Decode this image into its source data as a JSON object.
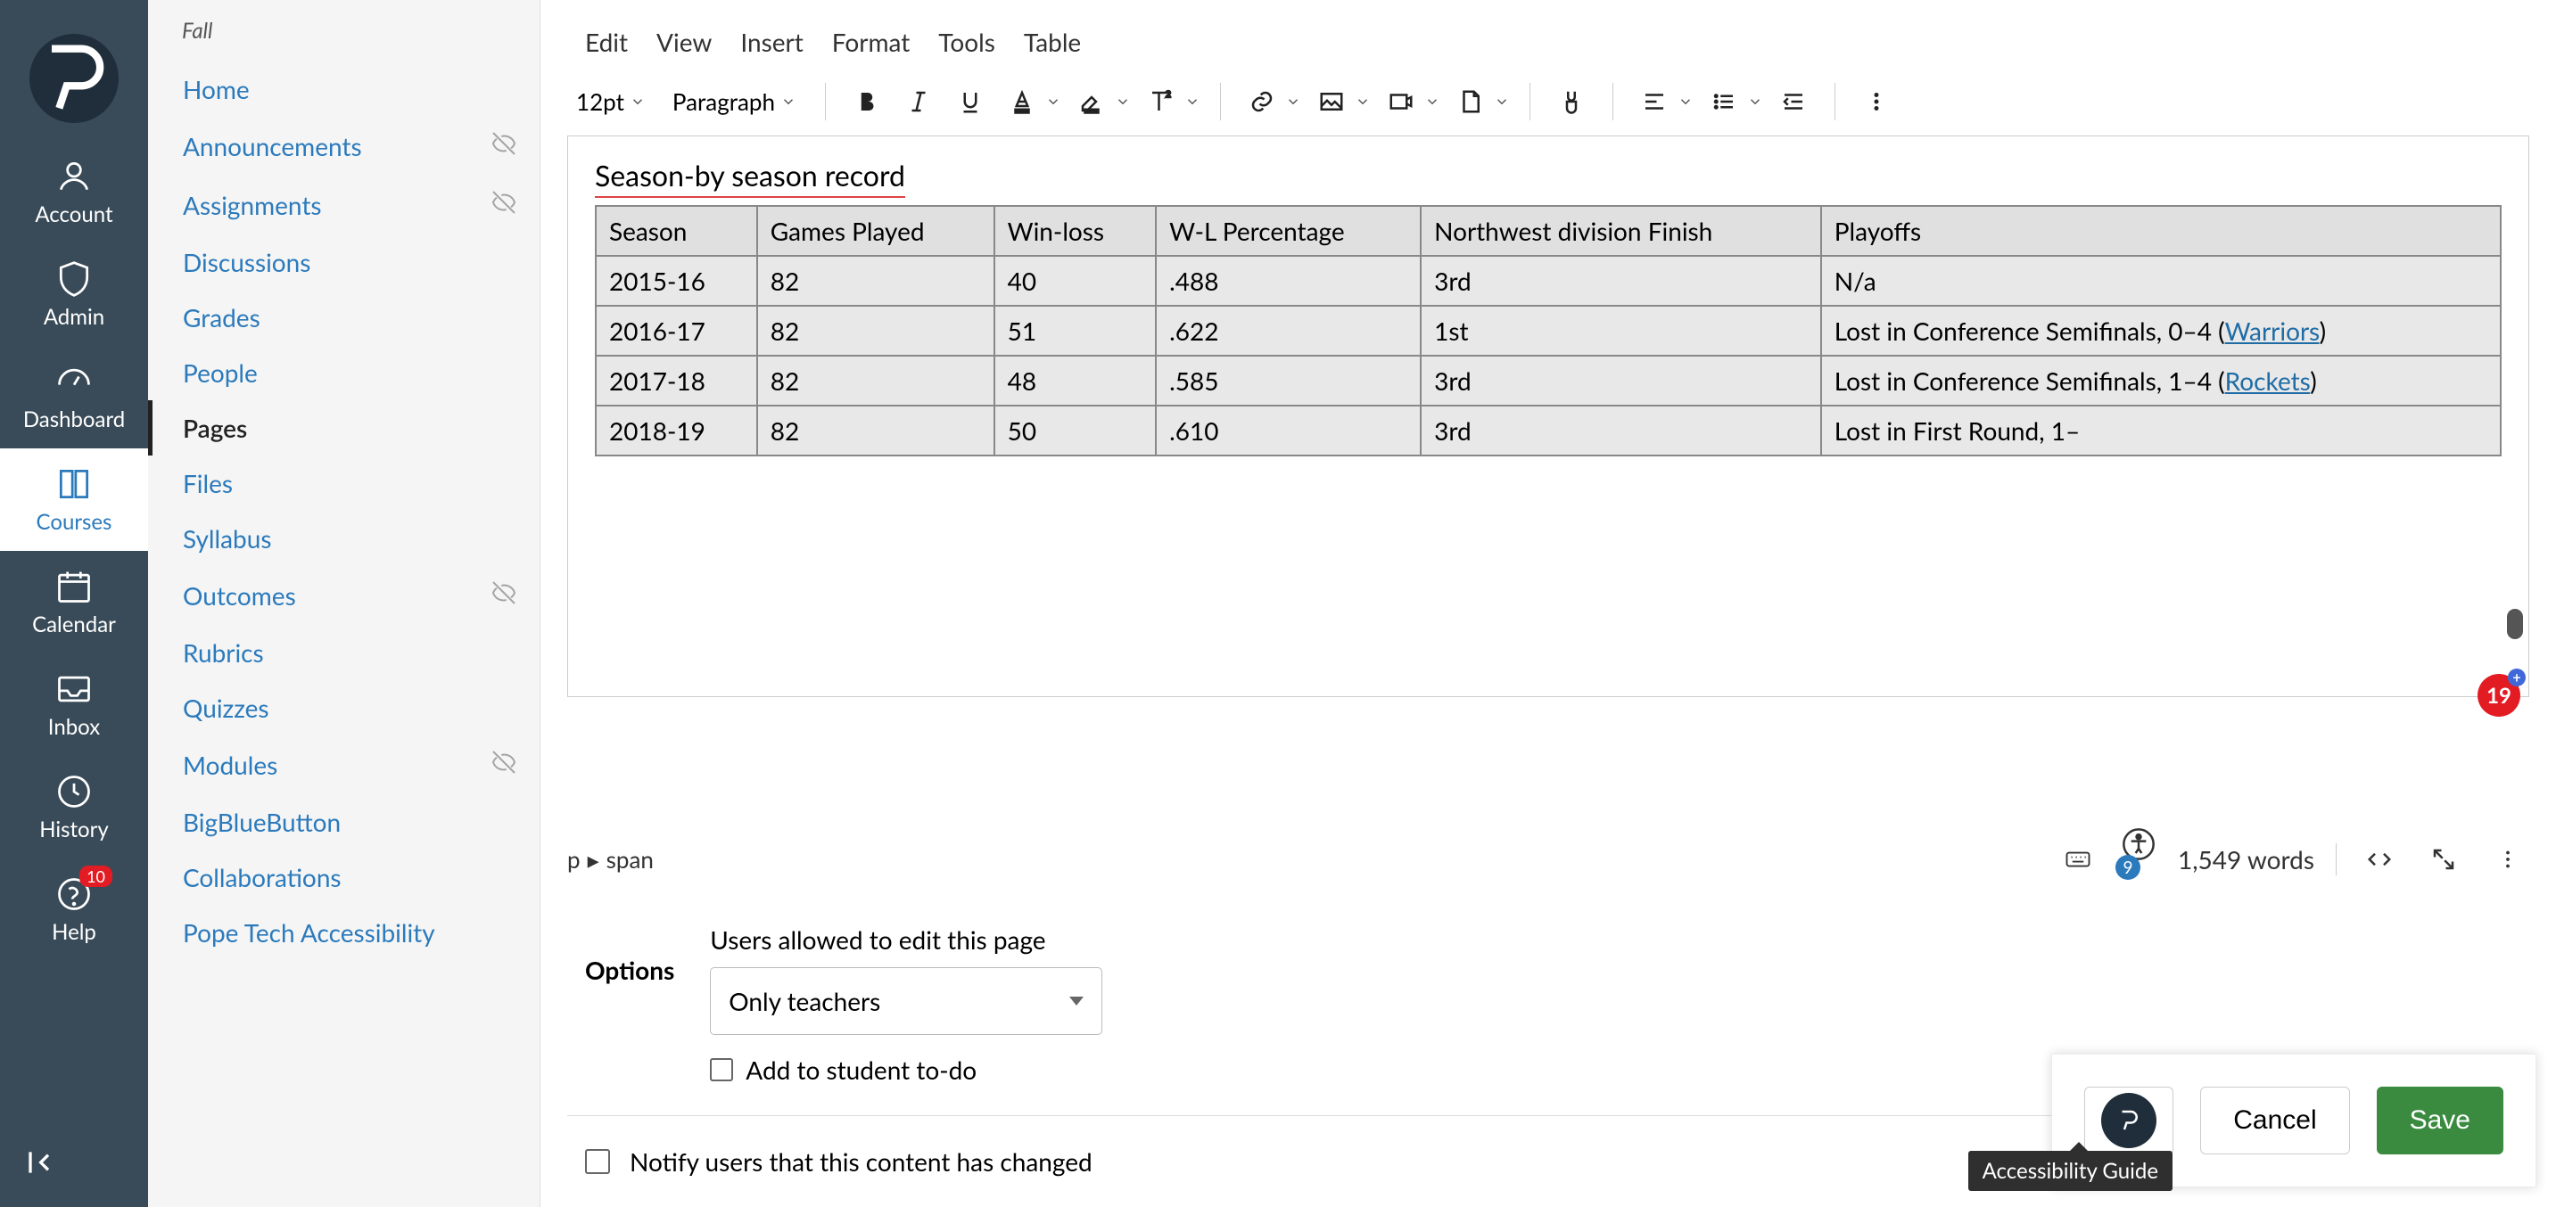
{
  "global_nav": {
    "items": [
      {
        "label": "Account",
        "icon": "user"
      },
      {
        "label": "Admin",
        "icon": "shield"
      },
      {
        "label": "Dashboard",
        "icon": "gauge"
      },
      {
        "label": "Courses",
        "icon": "book",
        "active": true
      },
      {
        "label": "Calendar",
        "icon": "calendar"
      },
      {
        "label": "Inbox",
        "icon": "inbox"
      },
      {
        "label": "History",
        "icon": "clock"
      },
      {
        "label": "Help",
        "icon": "help",
        "badge": "10"
      }
    ]
  },
  "course_nav": {
    "term": "Fall",
    "items": [
      {
        "label": "Home"
      },
      {
        "label": "Announcements",
        "hidden": true
      },
      {
        "label": "Assignments",
        "hidden": true
      },
      {
        "label": "Discussions"
      },
      {
        "label": "Grades"
      },
      {
        "label": "People"
      },
      {
        "label": "Pages",
        "active": true
      },
      {
        "label": "Files"
      },
      {
        "label": "Syllabus"
      },
      {
        "label": "Outcomes",
        "hidden": true
      },
      {
        "label": "Rubrics"
      },
      {
        "label": "Quizzes"
      },
      {
        "label": "Modules",
        "hidden": true
      },
      {
        "label": "BigBlueButton"
      },
      {
        "label": "Collaborations"
      },
      {
        "label": "Pope Tech Accessibility"
      }
    ]
  },
  "editor": {
    "menubar": [
      "Edit",
      "View",
      "Insert",
      "Format",
      "Tools",
      "Table"
    ],
    "font_size": "12pt",
    "block_format": "Paragraph",
    "doc_title": "Season-by season record",
    "table": {
      "headers": [
        "Season",
        "Games Played",
        "Win-loss",
        "W-L Percentage",
        "Northwest division Finish",
        "Playoffs"
      ],
      "rows": [
        {
          "season": "2015-16",
          "gp": "82",
          "wl": "40",
          "pct": ".488",
          "finish": "3rd",
          "playoffs": "N/a"
        },
        {
          "season": "2016-17",
          "gp": "82",
          "wl": "51",
          "pct": ".622",
          "finish": "1st",
          "playoffs": "Lost in Conference Semifinals, 0–4 (",
          "link": "Warriors",
          "tail": ")"
        },
        {
          "season": "2017-18",
          "gp": "82",
          "wl": "48",
          "pct": ".585",
          "finish": "3rd",
          "playoffs": "Lost in Conference Semifinals, 1–4 (",
          "link": "Rockets",
          "tail": ")"
        },
        {
          "season": "2018-19",
          "gp": "82",
          "wl": "50",
          "pct": ".610",
          "finish": "3rd",
          "playoffs": "Lost in First Round, 1–"
        }
      ]
    },
    "breadcrumb_p": "p",
    "breadcrumb_span": "span",
    "accessibility_count": "9",
    "word_count": "1,549 words"
  },
  "options": {
    "section_label": "Options",
    "edit_label": "Users allowed to edit this page",
    "select_value": "Only teachers",
    "todo_label": "Add to student to-do"
  },
  "notify_label": "Notify users that this content has changed",
  "footer": {
    "cancel": "Cancel",
    "save": "Save"
  },
  "tooltip": "Accessibility Guide",
  "floating_badge": "19"
}
